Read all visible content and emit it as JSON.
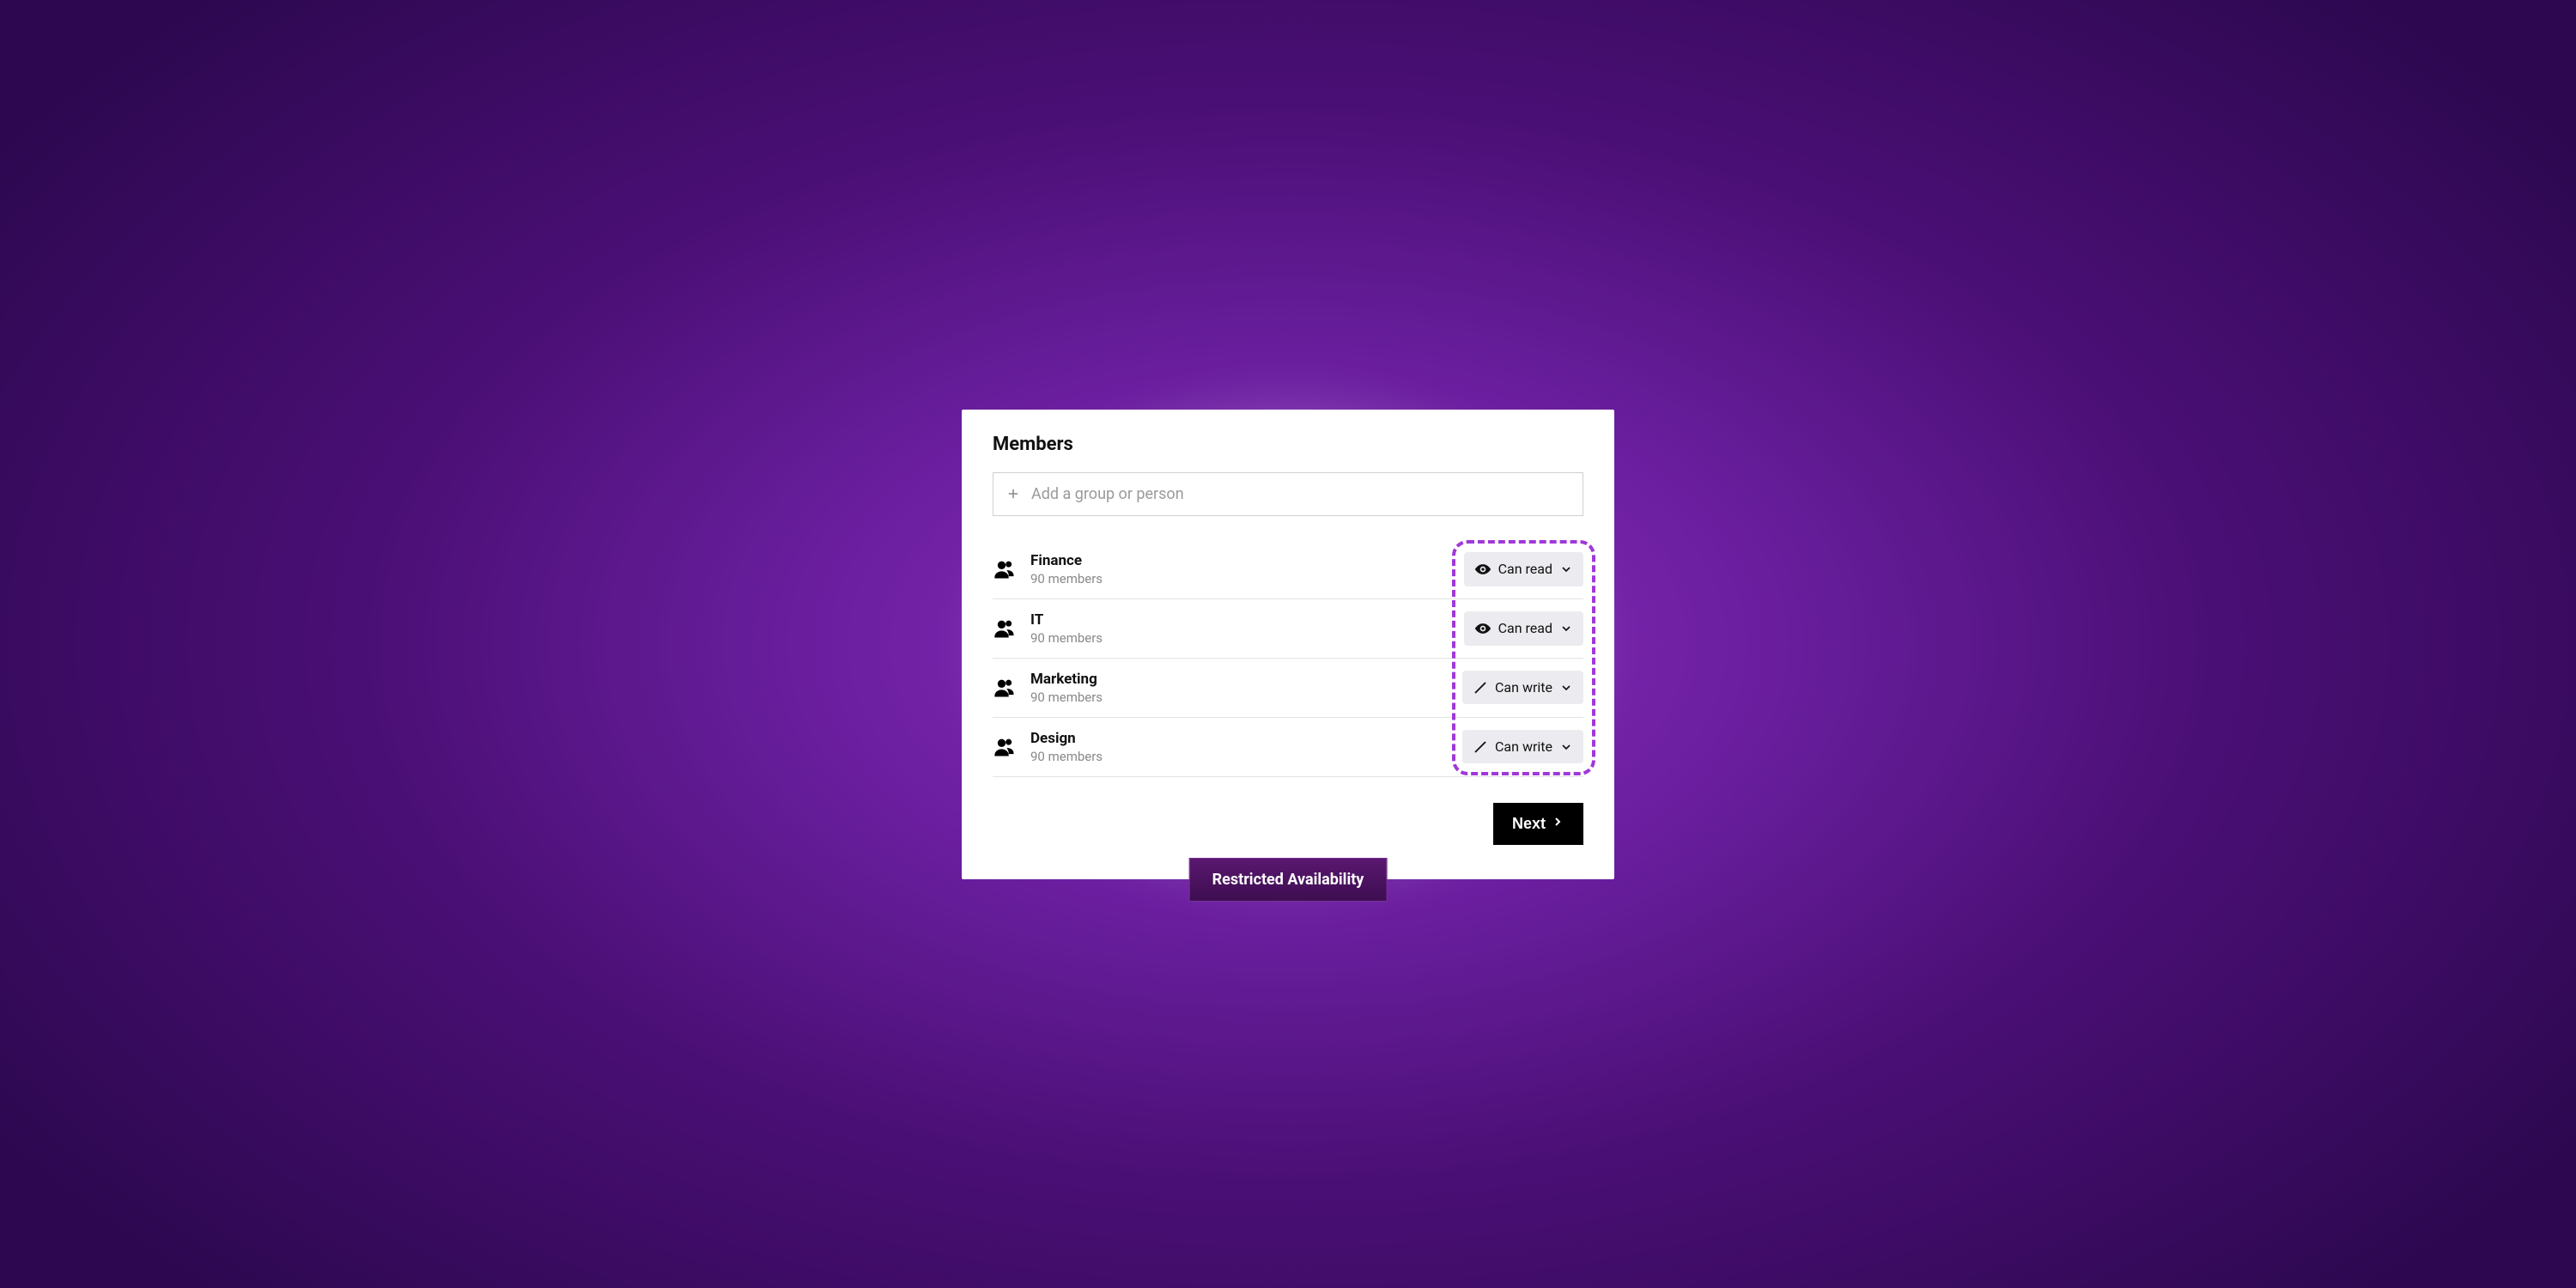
{
  "title": "Members",
  "add_placeholder": "Add a group or person",
  "groups": [
    {
      "name": "Finance",
      "sub": "90 members",
      "perm": "Can read",
      "perm_icon": "eye"
    },
    {
      "name": "IT",
      "sub": "90 members",
      "perm": "Can read",
      "perm_icon": "eye"
    },
    {
      "name": "Marketing",
      "sub": "90 members",
      "perm": "Can write",
      "perm_icon": "pencil"
    },
    {
      "name": "Design",
      "sub": "90 members",
      "perm": "Can write",
      "perm_icon": "pencil"
    }
  ],
  "next_label": "Next",
  "badge": "Restricted Availability",
  "colors": {
    "accent": "#a038d8"
  }
}
